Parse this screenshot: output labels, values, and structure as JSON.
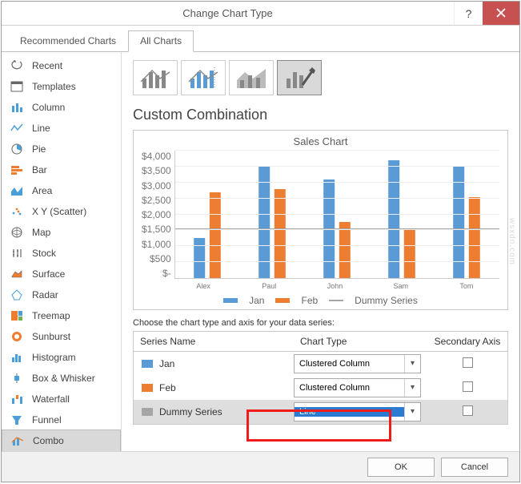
{
  "window": {
    "title": "Change Chart Type",
    "ok": "OK",
    "cancel": "Cancel"
  },
  "tabs": {
    "recommended": "Recommended Charts",
    "all": "All Charts"
  },
  "sidebar": {
    "items": [
      {
        "label": "Recent"
      },
      {
        "label": "Templates"
      },
      {
        "label": "Column"
      },
      {
        "label": "Line"
      },
      {
        "label": "Pie"
      },
      {
        "label": "Bar"
      },
      {
        "label": "Area"
      },
      {
        "label": "X Y (Scatter)"
      },
      {
        "label": "Map"
      },
      {
        "label": "Stock"
      },
      {
        "label": "Surface"
      },
      {
        "label": "Radar"
      },
      {
        "label": "Treemap"
      },
      {
        "label": "Sunburst"
      },
      {
        "label": "Histogram"
      },
      {
        "label": "Box & Whisker"
      },
      {
        "label": "Waterfall"
      },
      {
        "label": "Funnel"
      },
      {
        "label": "Combo"
      }
    ]
  },
  "main": {
    "heading": "Custom Combination",
    "instruction": "Choose the chart type and axis for your data series:",
    "headers": {
      "name": "Series Name",
      "type": "Chart Type",
      "axis": "Secondary Axis"
    },
    "series": [
      {
        "name": "Jan",
        "type": "Clustered Column",
        "color": "#5b9bd5"
      },
      {
        "name": "Feb",
        "type": "Clustered Column",
        "color": "#ed7d31"
      },
      {
        "name": "Dummy Series",
        "type": "Line",
        "color": "#a6a6a6"
      }
    ]
  },
  "chart_data": {
    "type": "bar",
    "title": "Sales Chart",
    "categories": [
      "Alex",
      "Paul",
      "John",
      "Sam",
      "Tom"
    ],
    "series": [
      {
        "name": "Jan",
        "values": [
          1250,
          3500,
          3100,
          3700,
          3500
        ],
        "color": "#5b9bd5"
      },
      {
        "name": "Feb",
        "values": [
          2700,
          2800,
          1750,
          1500,
          2550
        ],
        "color": "#ed7d31"
      },
      {
        "name": "Dummy Series",
        "values": [
          1500,
          1500,
          1500,
          1500,
          1500
        ],
        "color": "#a6a6a6",
        "type": "line"
      }
    ],
    "ylim": [
      0,
      4000
    ],
    "yticks": [
      "$-",
      "$500",
      "$1,000",
      "$1,500",
      "$2,000",
      "$2,500",
      "$3,000",
      "$3,500",
      "$4,000"
    ],
    "legend": [
      "Jan",
      "Feb",
      "Dummy Series"
    ]
  },
  "watermark": "wsxdn.com"
}
